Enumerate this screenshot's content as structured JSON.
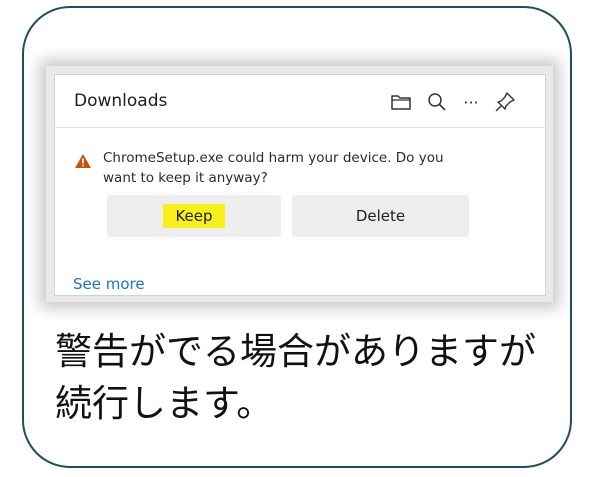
{
  "downloads_panel": {
    "title": "Downloads",
    "header_icons": [
      "folder-icon",
      "search-icon",
      "more-icon",
      "pin-icon"
    ],
    "more_glyph": "···",
    "warning": {
      "icon": "warning-icon",
      "text_line1": "ChromeSetup.exe could harm your device. Do you",
      "text_line2": "want to keep it anyway?"
    },
    "keep_label": "Keep",
    "delete_label": "Delete",
    "see_more_label": "See more"
  },
  "caption": {
    "line1": "警告がでる場合がありますが",
    "line2": "続行します。"
  },
  "colors": {
    "card_border": "#1f4e5f",
    "highlight": "#f7f01a",
    "link": "#1a73c7",
    "warning": "#c8540a"
  }
}
